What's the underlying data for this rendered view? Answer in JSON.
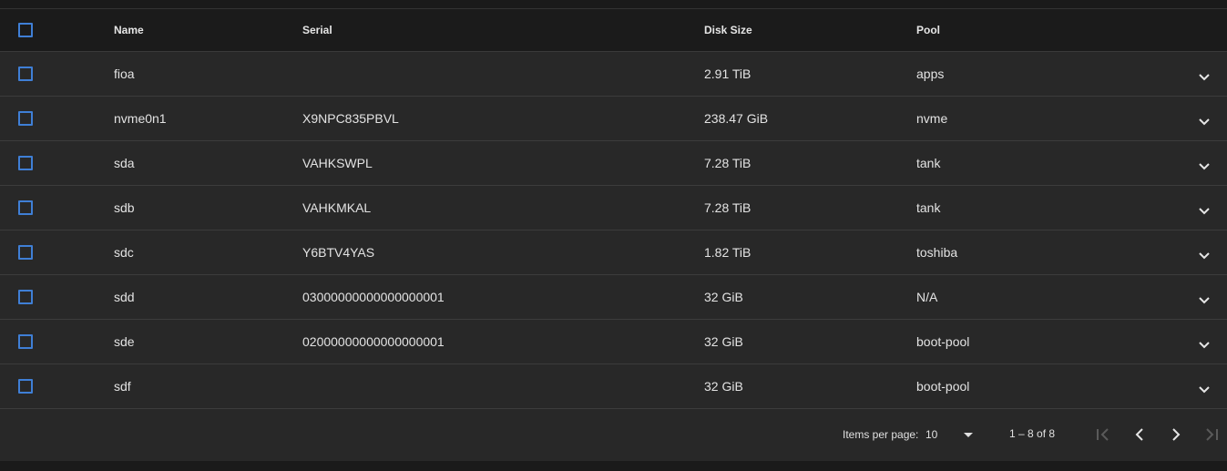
{
  "table": {
    "columns": {
      "name": "Name",
      "serial": "Serial",
      "disk_size": "Disk Size",
      "pool": "Pool"
    },
    "rows": [
      {
        "name": "fioa",
        "serial": "",
        "disk_size": "2.91 TiB",
        "pool": "apps"
      },
      {
        "name": "nvme0n1",
        "serial": "X9NPC835PBVL",
        "disk_size": "238.47 GiB",
        "pool": "nvme"
      },
      {
        "name": "sda",
        "serial": "VAHKSWPL",
        "disk_size": "7.28 TiB",
        "pool": "tank"
      },
      {
        "name": "sdb",
        "serial": "VAHKMKAL",
        "disk_size": "7.28 TiB",
        "pool": "tank"
      },
      {
        "name": "sdc",
        "serial": "Y6BTV4YAS",
        "disk_size": "1.82 TiB",
        "pool": "toshiba"
      },
      {
        "name": "sdd",
        "serial": "03000000000000000001",
        "disk_size": "32 GiB",
        "pool": "N/A"
      },
      {
        "name": "sde",
        "serial": "02000000000000000001",
        "disk_size": "32 GiB",
        "pool": "boot-pool"
      },
      {
        "name": "sdf",
        "serial": "",
        "disk_size": "32 GiB",
        "pool": "boot-pool"
      }
    ]
  },
  "paginator": {
    "items_per_page_label": "Items per page:",
    "items_per_page_value": "10",
    "range_label": "1 – 8 of 8"
  },
  "icons": {
    "select_all": "checkbox-icon",
    "row_select": "checkbox-icon",
    "expand": "chevron-down-icon",
    "first_page": "first-page-icon",
    "prev_page": "chevron-left-icon",
    "next_page": "chevron-right-icon",
    "last_page": "last-page-icon",
    "dropdown": "triangle-down-icon"
  },
  "colors": {
    "accent": "#3f7fd6",
    "row_bg": "#282828",
    "header_bg": "#1b1b1b"
  }
}
